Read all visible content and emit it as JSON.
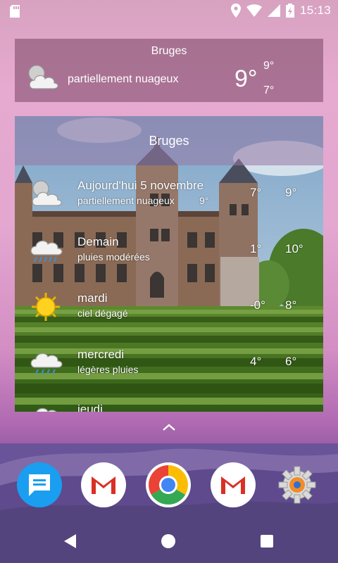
{
  "status_bar": {
    "time": "15:13",
    "icons": [
      "sd-card-icon",
      "location-icon",
      "wifi-icon",
      "signal-icon",
      "battery-charging-icon"
    ]
  },
  "small_widget": {
    "city": "Bruges",
    "condition": "partiellement nuageux",
    "temp": "9°",
    "high": "9°",
    "low": "7°",
    "icon": "partly-cloudy-icon"
  },
  "large_widget": {
    "city": "Bruges",
    "rows": [
      {
        "day": "Aujourd'hui 5 novembre",
        "desc": "partiellement nuageux",
        "current": "9°",
        "low": "7°",
        "high": "9°",
        "icon": "partly-cloudy-icon"
      },
      {
        "day": "Demain",
        "desc": "pluies modérées",
        "low": "1°",
        "high": "10°",
        "icon": "rain-cloud-icon"
      },
      {
        "day": "mardi",
        "desc": "ciel dégagé",
        "low": "-0°",
        "high": "8°",
        "icon": "sun-icon"
      },
      {
        "day": "mercredi",
        "desc": "légères pluies",
        "low": "4°",
        "high": "6°",
        "icon": "rain-cloud-icon"
      },
      {
        "day": "jeudi",
        "desc": "",
        "low": "",
        "high": "",
        "icon": "cloud-icon"
      }
    ]
  },
  "dock": {
    "apps": [
      "messages-icon",
      "gmail-icon",
      "chrome-icon",
      "gmail-icon",
      "settings-icon"
    ]
  },
  "colors": {
    "gmail_red": "#d93025",
    "chrome_blue": "#4285f4",
    "messages_blue": "#1a9ef0"
  }
}
